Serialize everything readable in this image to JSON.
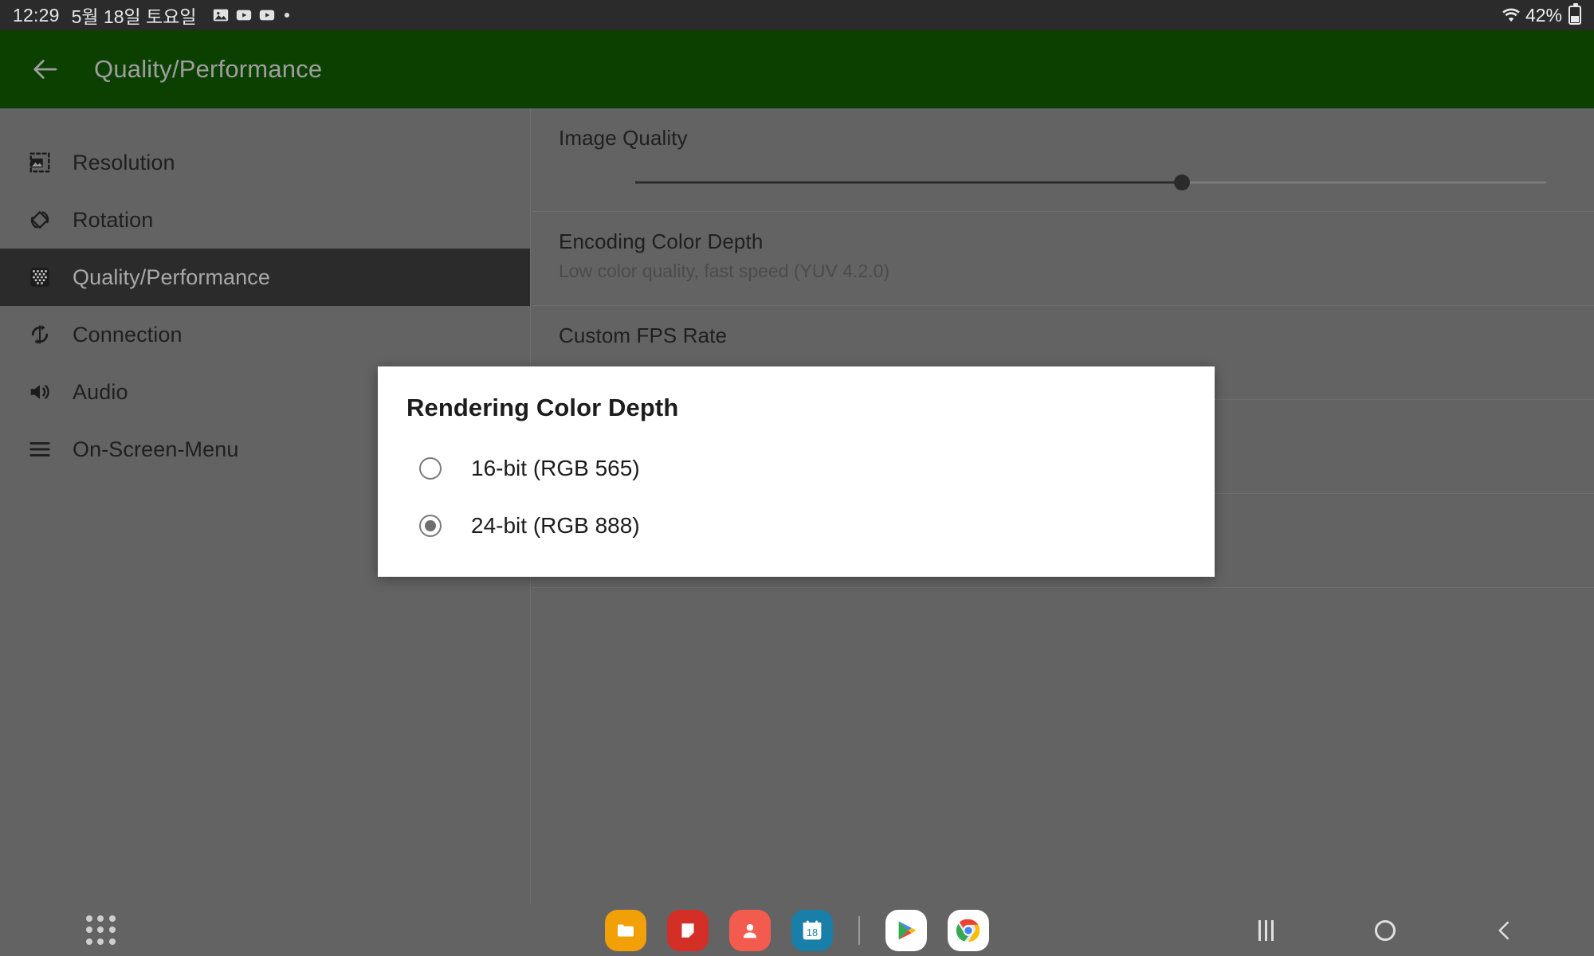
{
  "status_bar": {
    "time": "12:29",
    "date": "5월 18일 토요일",
    "icons": [
      "image-icon",
      "youtube-icon",
      "youtube-icon",
      "dot-indicator"
    ],
    "battery_percent": "42%",
    "wifi_icon": "wifi-icon",
    "battery_icon": "battery-icon"
  },
  "app_bar": {
    "back_icon": "back-arrow-icon",
    "title": "Quality/Performance",
    "background_color": "#0b4000",
    "title_color": "#9e9e9e"
  },
  "sidebar": {
    "items": [
      {
        "label": "Resolution",
        "icon": "resolution-icon",
        "selected": false
      },
      {
        "label": "Rotation",
        "icon": "rotation-icon",
        "selected": false
      },
      {
        "label": "Quality/Performance",
        "icon": "quality-performance-icon",
        "selected": true
      },
      {
        "label": "Connection",
        "icon": "connection-sync-icon",
        "selected": false
      },
      {
        "label": "Audio",
        "icon": "audio-speaker-icon",
        "selected": false
      },
      {
        "label": "On-Screen-Menu",
        "icon": "hamburger-menu-icon",
        "selected": false
      }
    ],
    "selected_background_color": "#2b2b2b"
  },
  "settings": {
    "image_quality": {
      "title": "Image Quality",
      "slider_value_percent": 60
    },
    "encoding_color_depth": {
      "title": "Encoding Color Depth",
      "subtitle": "Low color quality, fast speed (YUV 4.2.0)"
    },
    "custom_fps_rate": {
      "title": "Custom FPS Rate"
    }
  },
  "dialog": {
    "title": "Rendering Color Depth",
    "options": [
      {
        "label": "16-bit (RGB 565)",
        "selected": false
      },
      {
        "label": "24-bit (RGB 888)",
        "selected": true
      }
    ]
  },
  "taskbar": {
    "apps_button": "apps-grid-icon",
    "dock_items": [
      {
        "name": "my-files-icon",
        "color": "#f2a007"
      },
      {
        "name": "samsung-notes-icon",
        "color": "#d32f27"
      },
      {
        "name": "contacts-icon",
        "color": "#f25b4d"
      },
      {
        "name": "calendar-icon",
        "color": "#1a7fa8",
        "day": "18"
      },
      {
        "name": "dock-divider"
      },
      {
        "name": "play-store-icon",
        "color": "#ffffff"
      },
      {
        "name": "chrome-icon",
        "color": "#ffffff"
      }
    ],
    "nav_buttons": [
      {
        "name": "recents-button",
        "glyph": "|||"
      },
      {
        "name": "home-button",
        "glyph": "○"
      },
      {
        "name": "back-button",
        "glyph": "‹"
      }
    ]
  }
}
